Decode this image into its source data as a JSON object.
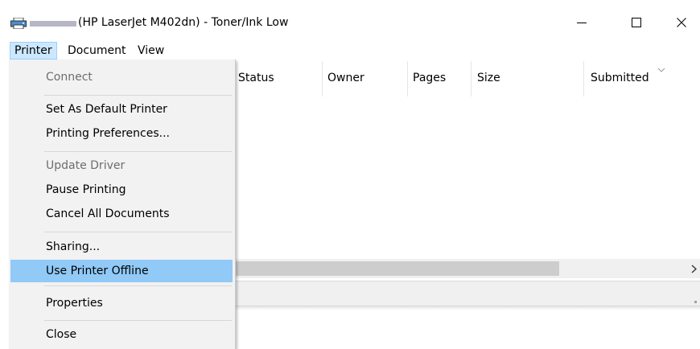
{
  "window": {
    "title": "(HP LaserJet M402dn) - Toner/Ink Low"
  },
  "menubar": {
    "items": [
      {
        "label": "Printer"
      },
      {
        "label": "Document"
      },
      {
        "label": "View"
      }
    ]
  },
  "columns": [
    {
      "label": "Status"
    },
    {
      "label": "Owner"
    },
    {
      "label": "Pages"
    },
    {
      "label": "Size"
    },
    {
      "label": "Submitted"
    }
  ],
  "printer_menu": {
    "items": [
      {
        "label": "Connect",
        "state": "disabled"
      },
      {
        "label": "Set As Default Printer",
        "state": "enabled"
      },
      {
        "label": "Printing Preferences...",
        "state": "enabled"
      },
      {
        "label": "Update Driver",
        "state": "disabled"
      },
      {
        "label": "Pause Printing",
        "state": "enabled"
      },
      {
        "label": "Cancel All Documents",
        "state": "enabled"
      },
      {
        "label": "Sharing...",
        "state": "enabled"
      },
      {
        "label": "Use Printer Offline",
        "state": "highlighted"
      },
      {
        "label": "Properties",
        "state": "enabled"
      },
      {
        "label": "Close",
        "state": "enabled"
      }
    ]
  },
  "colors": {
    "menu_bg": "#f2f2f2",
    "menu_highlight": "#91c9f7",
    "menubar_active": "#cce8ff",
    "disabled_text": "#6d6d6d"
  }
}
